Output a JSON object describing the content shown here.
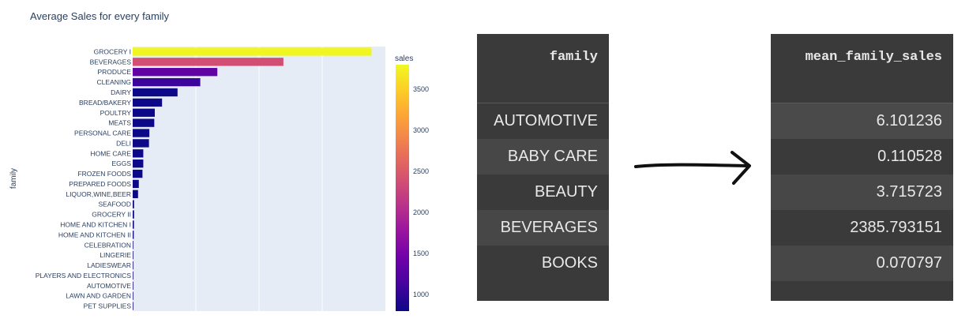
{
  "chart_data": {
    "type": "bar",
    "orientation": "horizontal",
    "title": "Average Sales for every family",
    "ylabel": "family",
    "xlim": [
      0,
      4000
    ],
    "grid": true,
    "colorbar": {
      "title": "sales",
      "range": [
        800,
        3800
      ],
      "ticks": [
        "3500",
        "3000",
        "2500",
        "2000",
        "1500",
        "1000"
      ]
    },
    "categories": [
      "GROCERY I",
      "BEVERAGES",
      "PRODUCE",
      "CLEANING",
      "DAIRY",
      "BREAD/BAKERY",
      "POULTRY",
      "MEATS",
      "PERSONAL CARE",
      "DELI",
      "HOME CARE",
      "EGGS",
      "FROZEN FOODS",
      "PREPARED FOODS",
      "LIQUOR,WINE,BEER",
      "SEAFOOD",
      "GROCERY II",
      "HOME AND KITCHEN I",
      "HOME AND KITCHEN II",
      "CELEBRATION",
      "LINGERIE",
      "LADIESWEAR",
      "PLAYERS AND ELECTRONICS",
      "AUTOMOTIVE",
      "LAWN AND GARDEN",
      "PET SUPPLIES"
    ],
    "values": [
      3780,
      2386,
      1340,
      1070,
      710,
      465,
      350,
      342,
      264,
      258,
      168,
      168,
      155,
      97,
      85,
      22,
      22,
      20,
      17,
      9,
      7,
      7,
      6,
      6,
      6,
      4
    ]
  },
  "left_table": {
    "header": "family",
    "rows": [
      "AUTOMOTIVE",
      "BABY CARE",
      "BEAUTY",
      "BEVERAGES",
      "BOOKS"
    ]
  },
  "right_table": {
    "header": "mean_family_sales",
    "rows": [
      "6.101236",
      "0.110528",
      "3.715723",
      "2385.793151",
      "0.070797"
    ]
  },
  "colors": {
    "plot_bg": "#e5ecf6",
    "table_bg": "#3a3a3a",
    "table_row_alt": "#474747"
  }
}
